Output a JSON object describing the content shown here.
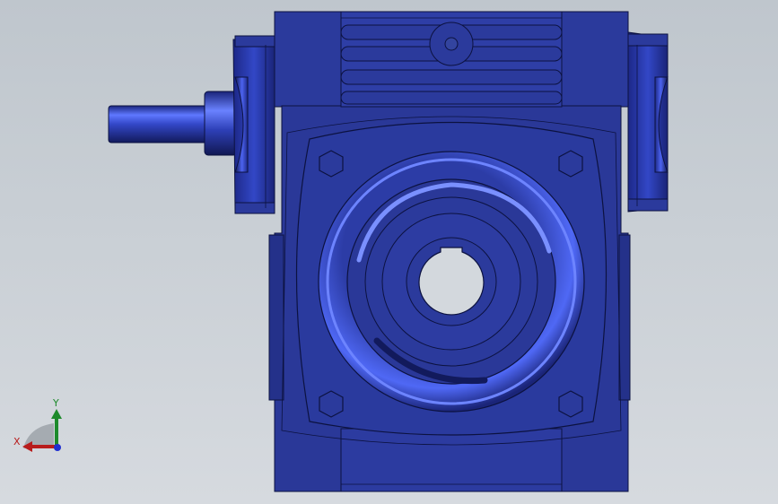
{
  "viewport": {
    "background_top": "#bfc6cd",
    "background_bottom": "#d6dadf"
  },
  "model": {
    "body_color": "#2b3a9c",
    "body_light": "#3c50c4",
    "body_dark": "#16206a",
    "outline": "#0c1240",
    "highlight": "#6d84ff"
  },
  "triad": {
    "x_label": "X",
    "y_label": "Y",
    "x_color": "#b81c1c",
    "y_color": "#1d8a2b",
    "z_color": "#1f2fd0"
  }
}
